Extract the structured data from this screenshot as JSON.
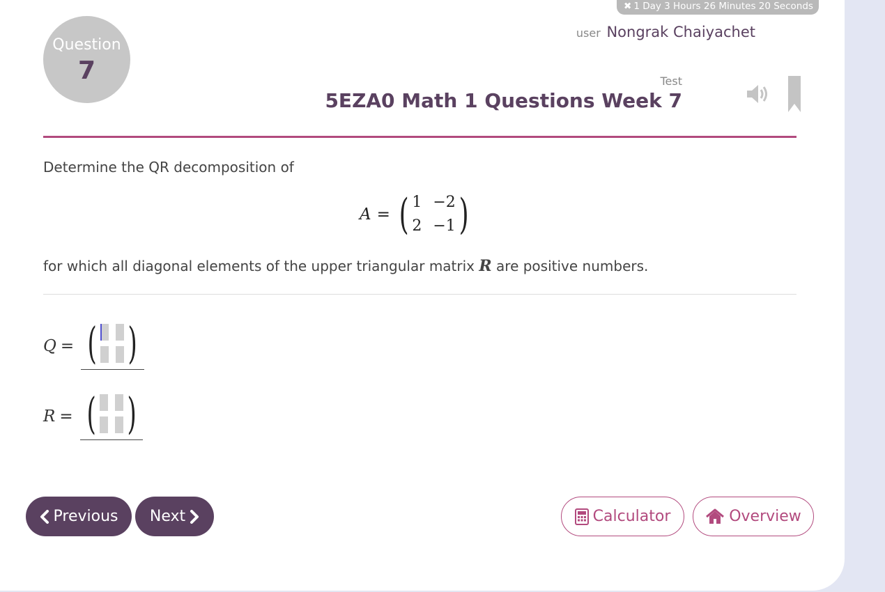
{
  "timer": {
    "icon": "close-icon",
    "text": "1 Day 3 Hours 26 Minutes 20 Seconds"
  },
  "question": {
    "label": "Question",
    "number": "7"
  },
  "user": {
    "prefix": "user",
    "name": "Nongrak Chaiyachet"
  },
  "test": {
    "label": "Test",
    "title": "5EZA0 Math 1 Questions Week 7"
  },
  "prompt": {
    "intro": "Determine the QR decomposition of",
    "matrix_name": "A",
    "equals": "=",
    "matrix": [
      [
        "1",
        "−2"
      ],
      [
        "2",
        "−1"
      ]
    ],
    "condition_before": "for which all diagonal elements of the upper triangular matrix ",
    "condition_var": "R",
    "condition_after": " are positive numbers."
  },
  "answers": [
    {
      "var": "Q",
      "equals": "="
    },
    {
      "var": "R",
      "equals": "="
    }
  ],
  "nav": {
    "previous": "Previous",
    "next": "Next",
    "calculator": "Calculator",
    "overview": "Overview"
  },
  "colors": {
    "primary": "#5a4160",
    "accent": "#b24a7e",
    "badge": "#c7c7c7",
    "page_bg": "#e3e6f3"
  }
}
